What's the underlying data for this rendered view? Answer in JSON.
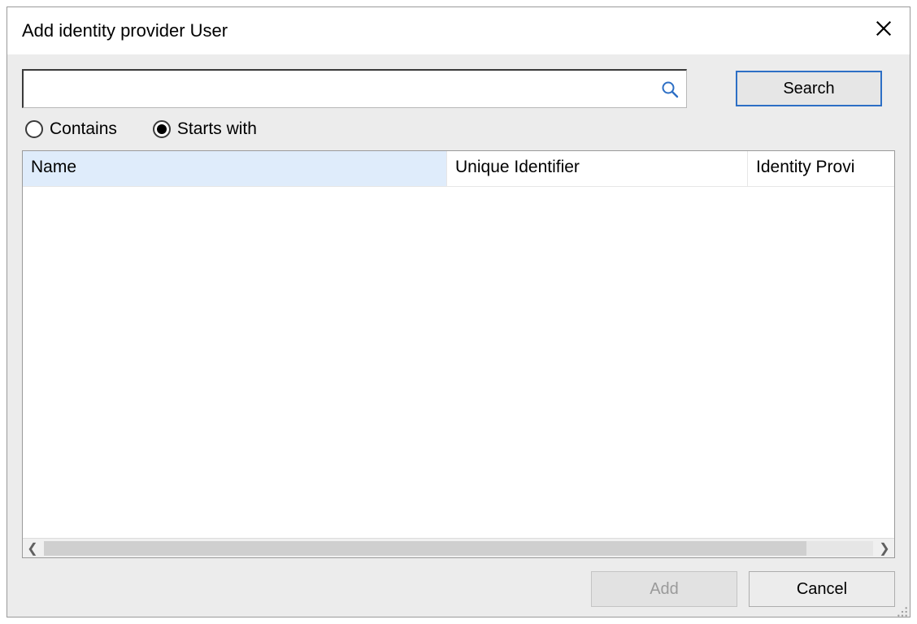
{
  "dialog": {
    "title": "Add identity provider User"
  },
  "search": {
    "value": "",
    "placeholder": "",
    "button_label": "Search"
  },
  "filter": {
    "contains_label": "Contains",
    "startswith_label": "Starts with",
    "selected": "startswith"
  },
  "grid": {
    "columns": {
      "name": "Name",
      "unique_identifier": "Unique Identifier",
      "identity_provider": "Identity Provi"
    },
    "rows": []
  },
  "buttons": {
    "add": "Add",
    "cancel": "Cancel"
  },
  "state": {
    "add_enabled": false
  }
}
